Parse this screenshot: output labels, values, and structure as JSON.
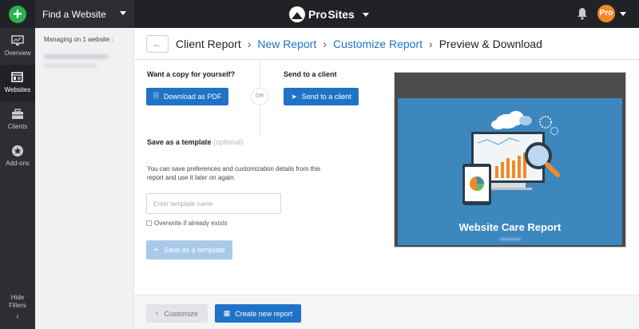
{
  "topbar": {
    "find_site_label": "Find a Website",
    "brand_pro": "Pro",
    "brand_sites": "Sites",
    "account_badge": "Pro"
  },
  "leftnav": {
    "items": [
      {
        "label": "Overview",
        "icon": "monitor-icon"
      },
      {
        "label": "Websites",
        "icon": "websites-icon",
        "active": true
      },
      {
        "label": "Clients",
        "icon": "briefcase-icon"
      },
      {
        "label": "Add-ons",
        "icon": "star-badge-icon"
      }
    ],
    "hide_filters": "Hide Filters"
  },
  "subpanel": {
    "managing_prefix": "Managing on ",
    "managing_count": "1 website",
    "managing_suffix": " :"
  },
  "breadcrumb": {
    "items": [
      "Client Report",
      "New Report",
      "Customize Report",
      "Preview & Download"
    ]
  },
  "copy_section": {
    "heading": "Want a copy for yourself?",
    "download_label": "Download as PDF"
  },
  "or_label": "OR",
  "send_section": {
    "heading": "Send to a client",
    "send_label": "Send to a client"
  },
  "template_section": {
    "heading": "Save as a template",
    "optional": "(optional)",
    "help": "You can save preferences and customization details from this report and use it later on again.",
    "input_placeholder": "Enter template name",
    "overwrite_label": "Overwrite if already exists",
    "save_label": "Save as a template"
  },
  "preview": {
    "title": "Website Care Report"
  },
  "footer": {
    "customize_label": "Customize",
    "create_label": "Create new report"
  },
  "colors": {
    "accent": "#1f73c7",
    "topbar": "#202226",
    "add_button": "#2bb24c",
    "pro_badge": "#f08a24",
    "preview_card": "#3d87bf"
  }
}
